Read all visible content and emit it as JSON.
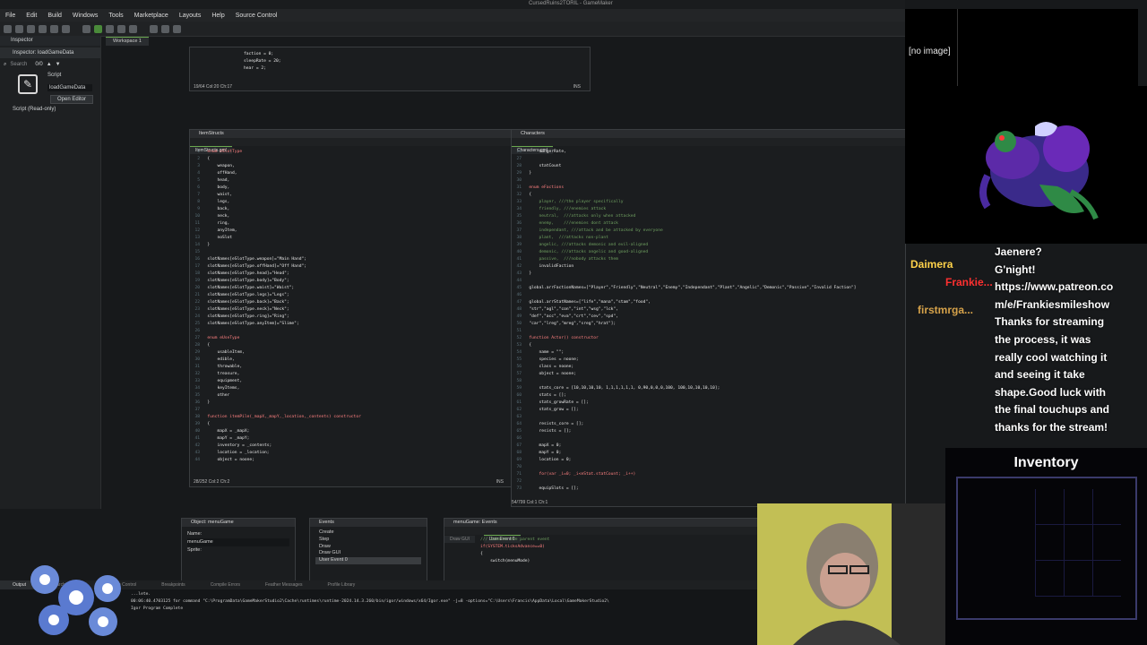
{
  "app": {
    "title": "CursedRuins2TORIL - GameMaker"
  },
  "menu": [
    "File",
    "Edit",
    "Build",
    "Windows",
    "Tools",
    "Marketplace",
    "Layouts",
    "Help",
    "Source Control"
  ],
  "inspector": {
    "tab": "Inspector",
    "title": "Inspector: loadGameData",
    "search_placeholder": "Search",
    "count": "0/0",
    "type": "Script",
    "name": "loadGameData",
    "open_editor": "Open Editor",
    "readonly": "Script (Read-only)"
  },
  "workspace_tab": "Workspace 1",
  "top_editor": {
    "lines": [
      "faction = 0;",
      "sleepRate = 20;",
      "",
      "hear = 2;"
    ],
    "status_left": "19/64 Col:20 Ch:17",
    "status_right": "INS"
  },
  "item_structs": {
    "window_title": "ItemStructs",
    "tab": "ItemStructs.gml",
    "status_left": "28/252 Col:2 Ch:2",
    "status_right": "INS",
    "lines": [
      "enum eSlotType",
      "{",
      "    weapon,",
      "    offHand,",
      "    head,",
      "    body,",
      "    waist,",
      "    legs,",
      "    back,",
      "    neck,",
      "    ring,",
      "    anyItem,",
      "    noSlot",
      "}",
      "",
      "slotNames[eSlotType.weapon]=\"Main Hand\";",
      "slotNames[eSlotType.offHand]=\"Off Hand\";",
      "slotNames[eSlotType.head]=\"Head\";",
      "slotNames[eSlotType.body]=\"Body\";",
      "slotNames[eSlotType.waist]=\"Waist\";",
      "slotNames[eSlotType.legs]=\"Legs\";",
      "slotNames[eSlotType.back]=\"Back\";",
      "slotNames[eSlotType.neck]=\"Neck\";",
      "slotNames[eSlotType.ring]=\"Ring\";",
      "slotNames[eSlotType.anyItem]=\"Slime\";",
      "",
      "enum eUseType",
      "{",
      "    usableItem,",
      "    edible,",
      "    throwable,",
      "    treasure,",
      "    equipment,",
      "    keyItems,",
      "    other",
      "}",
      "",
      "function itemPile(_mapX,_mapY,_location,_contents) constructor",
      "{",
      "    mapX = _mapX;",
      "    mapY = _mapY;",
      "    inventory = _contents;",
      "    location = _location;",
      "    object = noone;"
    ]
  },
  "characters": {
    "window_title": "Characters",
    "tab": "Characters.gml",
    "status_left": "54/799 Col:1 Ch:1",
    "lines": [
      "    hungerRate,",
      "",
      "    statCount",
      "}",
      "",
      "enum eFactions",
      "{",
      "    player, ///the player specifically",
      "    friendly, ///enemies attack",
      "    neutral,  ///attacks only when attacked",
      "    enemy,    ///enemies dont attack",
      "    independant, ///attack and be attacked by everyone",
      "    plant,  ///attacks non-plant",
      "    angelic, ///attacks demonic and evil-aligned",
      "    demonic, ///attacks angelic and good-aligned",
      "    passive,  ///nobody attacks them",
      "    invalidFaction",
      "}",
      "",
      "global.arrFactionNames=[\"Player\",\"Friendly\",\"Neutral\",\"Enemy\",\"Independant\",\"Plant\",\"Angelic\",\"Demonic\",\"Passive\",\"Invalid Faction\"]",
      "",
      "global.arrStatNames=[\"life\",\"mana\",\"stam\",\"food\",",
      "\"str\",\"agl\",\"con\",\"int\",\"wsg\",\"lck\",",
      "\"def\",\"acc\",\"eva\",\"crt\",\"cev\",\"spd\",",
      "\"car\",\"lreg\",\"mreg\",\"sreg\",\"hrat\"];",
      "",
      "function Actor() constructor",
      "{",
      "    name = \"\";",
      "    species = noone;",
      "    class = noone;",
      "    object = noone;",
      "",
      "    stats_core = [10,10,10,10, 1,1,1,1,1,1, 0,90,0,0,0,100, 100,10,10,10,10];",
      "    stats = [];",
      "    stats_growRate = [];",
      "    stats_grow = [];",
      "",
      "    resists_core = [];",
      "    resists = [];",
      "",
      "    mapX = 0;",
      "    mapY = 0;",
      "    location = 0;",
      "",
      "    for(var _i=0; _i<eStat.statCount; _i++)",
      "",
      "    equipSlots = [];"
    ]
  },
  "object_panel": {
    "title": "Object: menuGame",
    "name_label": "Name:",
    "name": "menuGame",
    "sprite_label": "Sprite:"
  },
  "events_panel": {
    "title": "Events",
    "events": [
      "Create",
      "Step",
      "Draw",
      "Draw GUI",
      "User Event 0"
    ]
  },
  "events_code": {
    "title": "menuGame: Events",
    "tabs": [
      "Draw GUI",
      "User Event 0"
    ],
    "lines": [
      "/// Inherit the parent event",
      "",
      "if(SYSTEM.ticksAdvance==0)",
      "{",
      "    switch(menuMode)"
    ]
  },
  "output": {
    "tabs": [
      "Output",
      "Search Results",
      "Source Control",
      "Breakpoints",
      "Compile Errors",
      "Feather Messages",
      "Profile Library"
    ],
    "lines": [
      "...lete.",
      "00:06:40.4703125 for command \"C:\\ProgramData\\GameMakerStudio2\\Cache\\runtimes\\runtime-2024.14.3.260/bin/igor/windows/x64/Igor.exe\" -j=8 -options=\"C:\\Users\\Francis\\AppData\\Local\\GameMakerStudio2\\",
      "Igor Program Complete"
    ]
  },
  "stream": {
    "no_image": "[no image]",
    "chat_names": [
      "Daimera",
      "Frankie...",
      "firstmrga..."
    ],
    "chat_messages": [
      "Jaenere?",
      "G'night!",
      "https://www.patreon.co",
      "m/e/Frankiesmileshow",
      "Thanks for streaming",
      "the process, it was",
      "really cool watching it",
      "and seeing it take",
      "shape.Good luck with",
      "the final touchups and",
      "thanks for the stream!"
    ],
    "inventory_title": "Inventory"
  },
  "colors": {
    "accent": "#6aa84f",
    "keyword": "#ff8080",
    "comment": "#6fa060",
    "string": "#f7e67a",
    "cam_bg": "#c2bf55"
  }
}
